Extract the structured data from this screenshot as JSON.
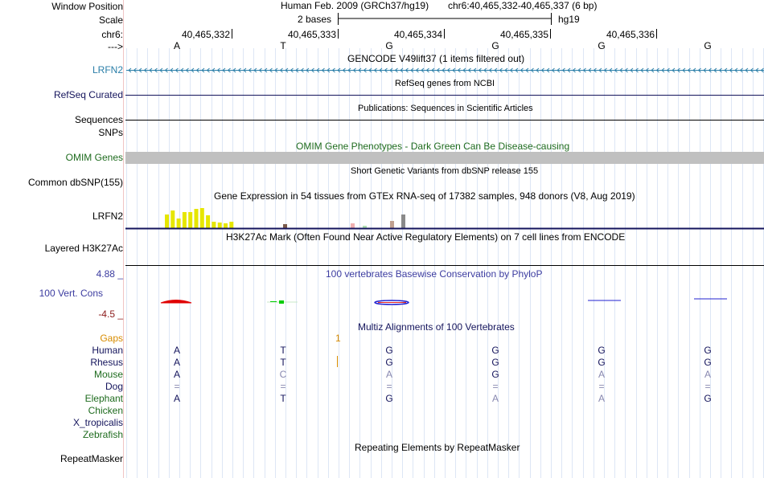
{
  "header": {
    "window_position_label": "Window Position",
    "scale_label": "Scale",
    "chrom_label": "chr6:",
    "strand_label": "--->",
    "assembly": "Human Feb. 2009 (GRCh37/hg19)",
    "position": "chr6:40,465,332-40,465,337 (6 bp)",
    "scale_text": "2 bases",
    "db": "hg19",
    "ticks": [
      "40,465,332",
      "40,465,333",
      "40,465,334",
      "40,465,335",
      "40,465,336"
    ],
    "bases": [
      "A",
      "T",
      "G",
      "G",
      "G",
      "G"
    ]
  },
  "tracks": {
    "gencode": {
      "label": "LRFN2",
      "title": "GENCODE V49lift37 (1 items filtered out)",
      "color": "#2a7ea8"
    },
    "refseq": {
      "label": "RefSeq Curated",
      "title": "RefSeq genes from NCBI",
      "color": "#14145c"
    },
    "publications": {
      "title": "Publications: Sequences in Scientific Articles"
    },
    "sequences": {
      "label": "Sequences"
    },
    "snps": {
      "label": "SNPs"
    },
    "omim": {
      "label": "OMIM Genes",
      "title": "OMIM Gene Phenotypes - Dark Green Can Be Disease-causing",
      "color": "#1e6b1e"
    },
    "dbsnp": {
      "label": "Common dbSNP(155)",
      "title": "Short Genetic Variants from dbSNP release 155"
    },
    "gtex": {
      "label": "LRFN2",
      "title": "Gene Expression in 54 tissues from GTEx RNA-seq of 17382 samples, 948 donors (V8, Aug 2019)",
      "bar_colors": [
        "#e6e600",
        "#e6e600",
        "#e6e600",
        "#e6e600",
        "#e6e600",
        "#e6e600",
        "#e6e600",
        "#e6e600",
        "#e6e600",
        "#e6e600",
        "#e6e600",
        "#e6e600"
      ],
      "bar_values": [
        0.42,
        0.55,
        0.3,
        0.5,
        0.5,
        0.6,
        0.62,
        0.4,
        0.2,
        0.18,
        0.15,
        0.2
      ],
      "other_bars": [
        {
          "color": "#7a5a4a",
          "value": 0.12
        },
        {
          "color": "#f0b0b0",
          "value": 0.14
        },
        {
          "color": "#b0e0b0",
          "value": 0.08
        },
        {
          "color": "#c0a090",
          "value": 0.22
        },
        {
          "color": "#8a8a8a",
          "value": 0.42
        }
      ]
    },
    "h3k27ac": {
      "label": "Layered H3K27Ac",
      "title": "H3K27Ac Mark (Often Found Near Active Regulatory Elements) on 7 cell lines from ENCODE"
    },
    "phylop": {
      "label": "100 Vert. Cons",
      "title": "100 vertebrates Basewise Conservation by PhyloP",
      "max": "4.88 _",
      "min": "-4.5 _",
      "color": "#3c3ca0"
    },
    "multiz": {
      "title": "Multiz Alignments of 100 Vertebrates",
      "gaps_label": "Gaps",
      "gap_mark": "1",
      "species": [
        {
          "name": "Human",
          "color": "#14145c",
          "bases": [
            "A",
            "T",
            "G",
            "G",
            "G",
            "G"
          ]
        },
        {
          "name": "Rhesus",
          "color": "#14145c",
          "bases": [
            "A",
            "T",
            "G",
            "G",
            "G",
            "G"
          ]
        },
        {
          "name": "Mouse",
          "color": "#1e6b1e",
          "bases": [
            "A",
            "C",
            "A",
            "G",
            "A",
            "A"
          ]
        },
        {
          "name": "Dog",
          "color": "#14145c",
          "bases": [
            "=",
            "=",
            "=",
            "=",
            "=",
            "="
          ]
        },
        {
          "name": "Elephant",
          "color": "#1e6b1e",
          "bases": [
            "A",
            "T",
            "G",
            "A",
            "A",
            "G"
          ]
        },
        {
          "name": "Chicken",
          "color": "#1e6b1e",
          "bases": [
            "",
            "",
            "",
            "",
            "",
            ""
          ]
        },
        {
          "name": "X_tropicalis",
          "color": "#14145c",
          "bases": [
            "",
            "",
            "",
            "",
            "",
            ""
          ]
        },
        {
          "name": "Zebrafish",
          "color": "#1e6b1e",
          "bases": [
            "",
            "",
            "",
            "",
            "",
            ""
          ]
        }
      ]
    },
    "repeatmasker": {
      "label": "RepeatMasker",
      "title": "Repeating Elements by RepeatMasker"
    }
  }
}
